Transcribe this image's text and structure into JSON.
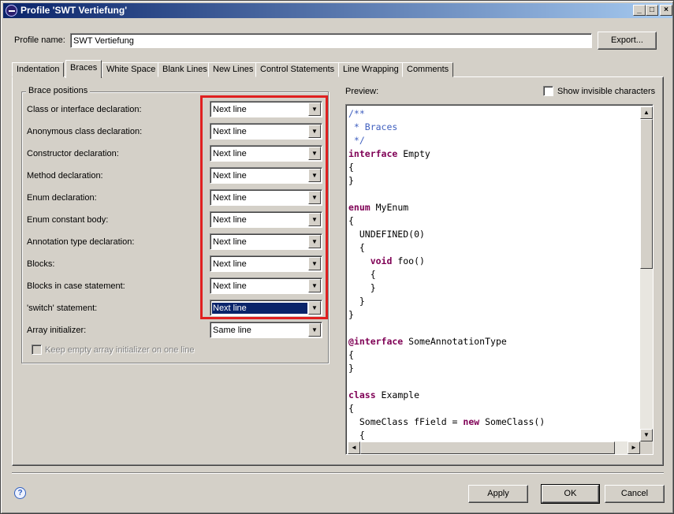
{
  "window": {
    "title": "Profile 'SWT Vertiefung'",
    "minimize": "_",
    "maximize": "□",
    "close": "×"
  },
  "profile": {
    "label": "Profile name:",
    "value": "SWT Vertiefung",
    "export_label": "Export..."
  },
  "tabs": [
    "Indentation",
    "Braces",
    "White Space",
    "Blank Lines",
    "New Lines",
    "Control Statements",
    "Line Wrapping",
    "Comments"
  ],
  "active_tab": "Braces",
  "brace_positions": {
    "title": "Brace positions",
    "rows": [
      {
        "label": "Class or interface declaration:",
        "value": "Next line"
      },
      {
        "label": "Anonymous class declaration:",
        "value": "Next line"
      },
      {
        "label": "Constructor declaration:",
        "value": "Next line"
      },
      {
        "label": "Method declaration:",
        "value": "Next line"
      },
      {
        "label": "Enum declaration:",
        "value": "Next line"
      },
      {
        "label": "Enum constant body:",
        "value": "Next line"
      },
      {
        "label": "Annotation type declaration:",
        "value": "Next line"
      },
      {
        "label": "Blocks:",
        "value": "Next line"
      },
      {
        "label": "Blocks in case statement:",
        "value": "Next line"
      },
      {
        "label": "'switch' statement:",
        "value": "Next line"
      },
      {
        "label": "Array initializer:",
        "value": "Same line"
      }
    ],
    "keep_empty_label": "Keep empty array initializer on one line"
  },
  "preview": {
    "label": "Preview:",
    "show_invisible_label": "Show invisible characters"
  },
  "buttons": {
    "apply": "Apply",
    "ok": "OK",
    "cancel": "Cancel",
    "help": "?"
  },
  "icons": {
    "dropdown": "▼",
    "scroll_up": "▲",
    "scroll_down": "▼",
    "scroll_left": "◄",
    "scroll_right": "►"
  },
  "highlight_color": "#e02020"
}
